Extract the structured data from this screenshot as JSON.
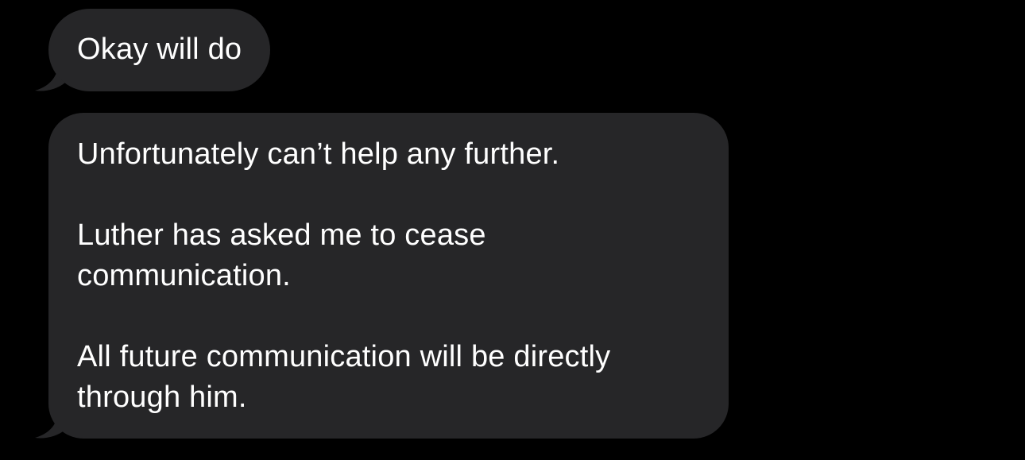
{
  "theme": {
    "background": "#000000",
    "bubble_incoming": "#262628",
    "text": "#ffffff"
  },
  "messages": [
    {
      "direction": "incoming",
      "paragraphs": [
        "Okay will do"
      ]
    },
    {
      "direction": "incoming",
      "paragraphs": [
        "Unfortunately can’t help any further.",
        "Luther has asked me to cease communication.",
        "All future communication will be directly through him."
      ]
    }
  ]
}
